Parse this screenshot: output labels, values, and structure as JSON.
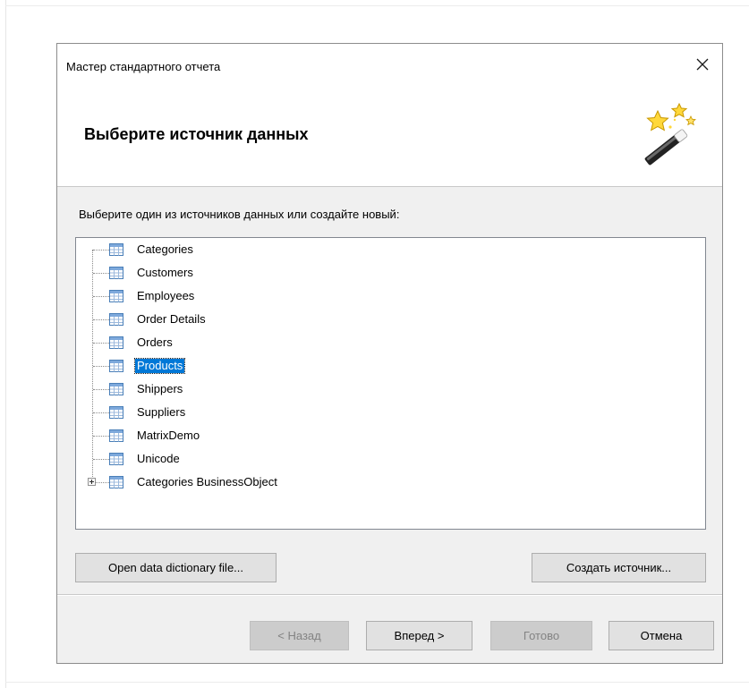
{
  "dialog": {
    "title": "Мастер стандартного отчета",
    "heading": "Выберите источник данных",
    "instruction": "Выберите один из источников данных или создайте новый:"
  },
  "tree": {
    "items": [
      {
        "label": "Categories",
        "selected": false,
        "expandable": false
      },
      {
        "label": "Customers",
        "selected": false,
        "expandable": false
      },
      {
        "label": "Employees",
        "selected": false,
        "expandable": false
      },
      {
        "label": "Order Details",
        "selected": false,
        "expandable": false
      },
      {
        "label": "Orders",
        "selected": false,
        "expandable": false
      },
      {
        "label": "Products",
        "selected": true,
        "expandable": false
      },
      {
        "label": "Shippers",
        "selected": false,
        "expandable": false
      },
      {
        "label": "Suppliers",
        "selected": false,
        "expandable": false
      },
      {
        "label": "MatrixDemo",
        "selected": false,
        "expandable": false
      },
      {
        "label": "Unicode",
        "selected": false,
        "expandable": false
      },
      {
        "label": "Categories BusinessObject",
        "selected": false,
        "expandable": true
      }
    ]
  },
  "buttons": {
    "open_dictionary": "Open data dictionary file...",
    "create_source": "Создать источник...",
    "back": "< Назад",
    "next": "Вперед >",
    "finish": "Готово",
    "cancel": "Отмена"
  },
  "icons": {
    "close": "close-icon",
    "wizard": "magic-wand-icon",
    "table": "table-icon",
    "expand": "plus-expander-icon"
  },
  "colors": {
    "selection": "#0078d7",
    "dialog_bg": "#f0f0f0",
    "header_bg": "#ffffff"
  }
}
